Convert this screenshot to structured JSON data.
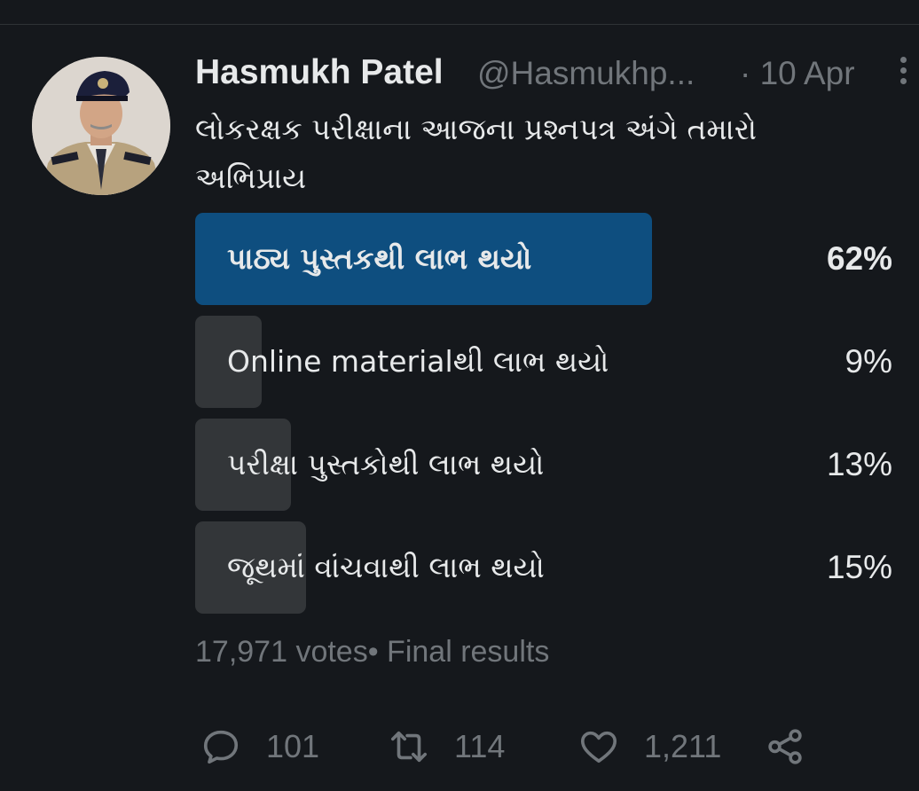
{
  "tweet": {
    "author_name": "Hasmukh Patel",
    "handle": "@Hasmukhp...",
    "date": "· 10 Apr",
    "text": "લોકરક્ષક પરીક્ષાના આજના પ્રશ્નપત્ર અંગે તમારો અભિપ્રાય"
  },
  "poll": {
    "options": [
      {
        "label": "પાઠ્ય પુસ્તકથી લાભ થયો",
        "percent_text": "62%",
        "percent": 62,
        "winner": true
      },
      {
        "label": "Online materialથી લાભ થયો",
        "percent_text": "9%",
        "percent": 9,
        "winner": false
      },
      {
        "label": "પરીક્ષા પુસ્તકોથી લાભ થયો",
        "percent_text": "13%",
        "percent": 13,
        "winner": false
      },
      {
        "label": "જૂથમાં વાંચવાથી લાભ થયો",
        "percent_text": "15%",
        "percent": 15,
        "winner": false
      }
    ],
    "votes": "17,971 votes",
    "status": "• Final results"
  },
  "actions": {
    "reply_count": "101",
    "retweet_count": "114",
    "like_count": "1,211"
  },
  "icons": {
    "reply": "reply-icon",
    "retweet": "retweet-icon",
    "like": "heart-icon",
    "share": "share-icon",
    "more": "more-icon"
  },
  "colors": {
    "background": "#15181c",
    "winner_bar": "#0e4e7f",
    "option_bar": "#333639",
    "secondary_text": "#71767b",
    "primary_text": "#e7e9ea"
  }
}
